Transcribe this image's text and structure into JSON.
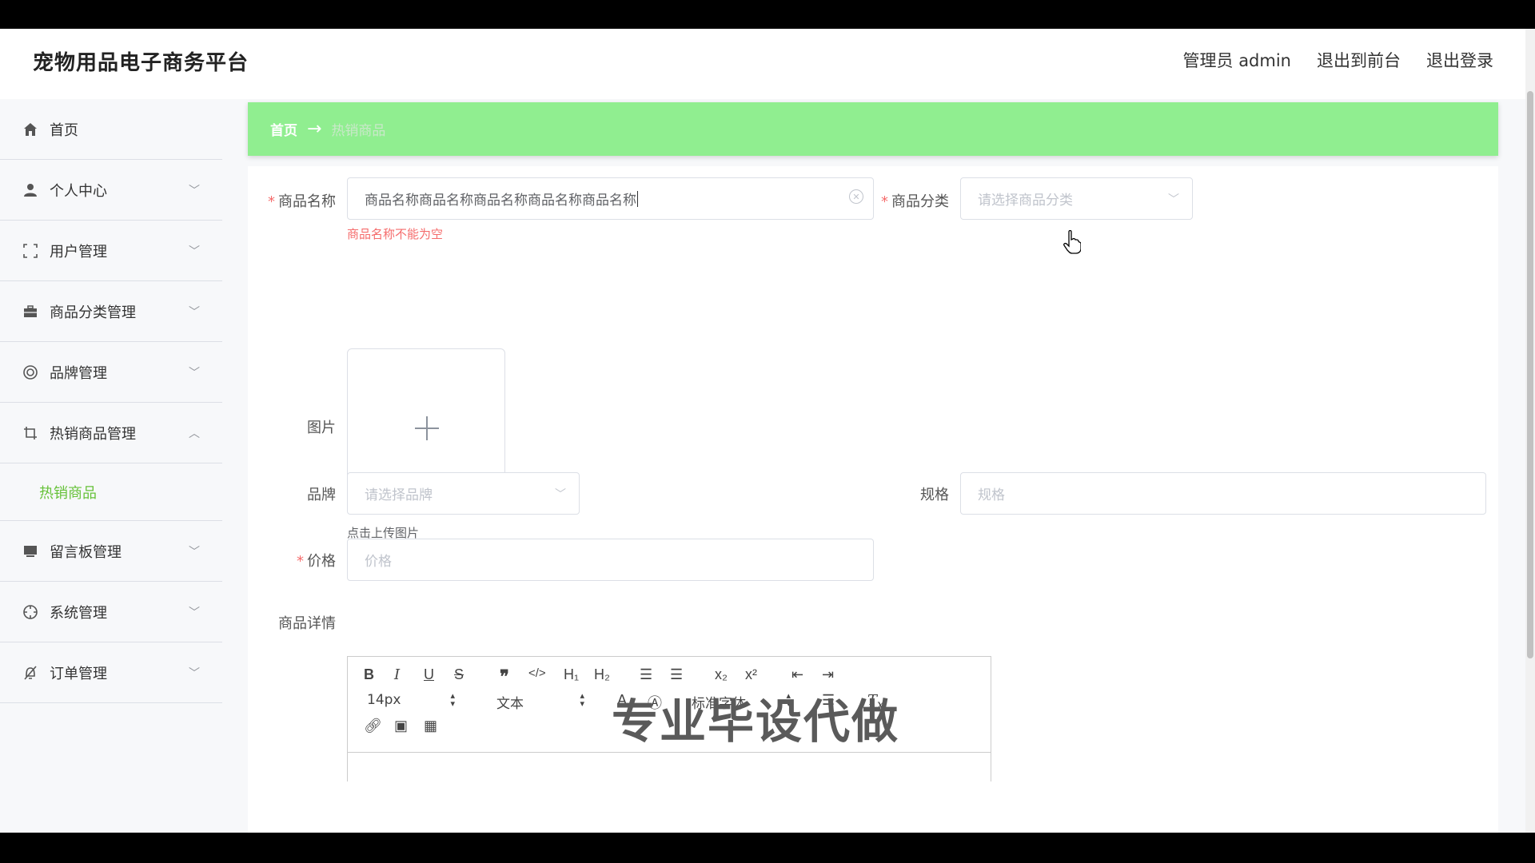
{
  "app": {
    "title": "宠物用品电子商务平台"
  },
  "header": {
    "admin_label": "管理员 admin",
    "to_front": "退出到前台",
    "logout": "退出登录"
  },
  "sidebar": {
    "items": [
      {
        "label": "首页",
        "icon": "home-icon"
      },
      {
        "label": "个人中心",
        "icon": "user-icon"
      },
      {
        "label": "用户管理",
        "icon": "fullscreen-icon"
      },
      {
        "label": "商品分类管理",
        "icon": "briefcase-icon"
      },
      {
        "label": "品牌管理",
        "icon": "circle-icon"
      },
      {
        "label": "热销商品管理",
        "icon": "crop-icon"
      },
      {
        "label": "留言板管理",
        "icon": "monitor-icon"
      },
      {
        "label": "系统管理",
        "icon": "compass-icon"
      },
      {
        "label": "订单管理",
        "icon": "bell-off-icon"
      }
    ],
    "sub_item": "热销商品"
  },
  "breadcrumb": {
    "home": "首页",
    "current": "热销商品"
  },
  "form": {
    "name_label": "商品名称",
    "name_value": "商品名称商品名称商品名称商品名称商品名称",
    "name_error": "商品名称不能为空",
    "category_label": "商品分类",
    "category_placeholder": "请选择商品分类",
    "image_label": "图片",
    "upload_hint": "点击上传图片",
    "brand_label": "品牌",
    "brand_placeholder": "请选择品牌",
    "spec_label": "规格",
    "spec_placeholder": "规格",
    "price_label": "价格",
    "price_placeholder": "价格",
    "detail_label": "商品详情"
  },
  "editor": {
    "font_size": "14px",
    "header_select": "文本",
    "font_family": "标准字体",
    "h1": "H₁",
    "h2": "H₂"
  },
  "watermark": "专业毕设代做",
  "colors": {
    "accent_green": "#90ee90",
    "active_green": "#67c23a",
    "error_red": "#f56c6c"
  }
}
